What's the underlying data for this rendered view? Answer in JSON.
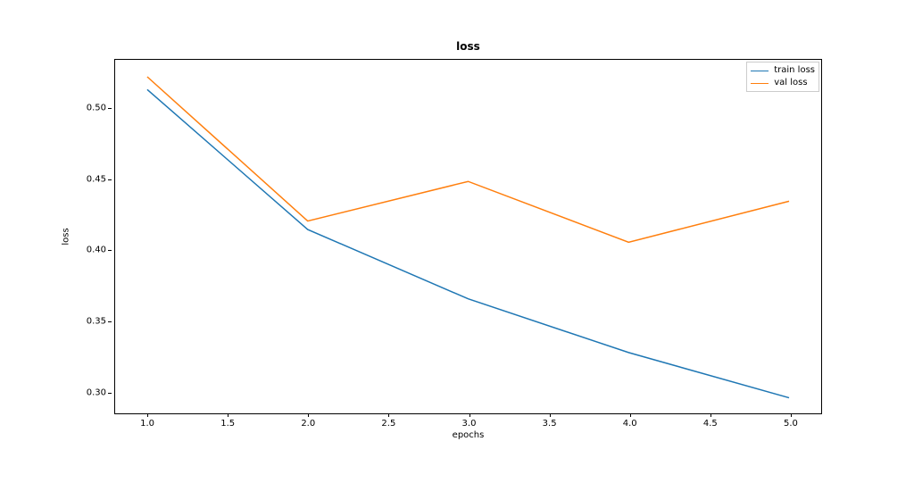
{
  "chart_data": {
    "type": "line",
    "title": "loss",
    "xlabel": "epochs",
    "ylabel": "loss",
    "x": [
      1.0,
      2.0,
      3.0,
      4.0,
      5.0
    ],
    "xticks": [
      "1.0",
      "1.5",
      "2.0",
      "2.5",
      "3.0",
      "3.5",
      "4.0",
      "4.5",
      "5.0"
    ],
    "yticks": [
      "0.30",
      "0.35",
      "0.40",
      "0.45",
      "0.50"
    ],
    "xlim": [
      0.8,
      5.2
    ],
    "ylim": [
      0.284,
      0.534
    ],
    "series": [
      {
        "name": "train loss",
        "color": "#1f77b4",
        "values": [
          0.513,
          0.414,
          0.365,
          0.327,
          0.295
        ]
      },
      {
        "name": "val loss",
        "color": "#ff7f0e",
        "values": [
          0.522,
          0.42,
          0.448,
          0.405,
          0.434
        ]
      }
    ],
    "legend_position": "upper right"
  }
}
